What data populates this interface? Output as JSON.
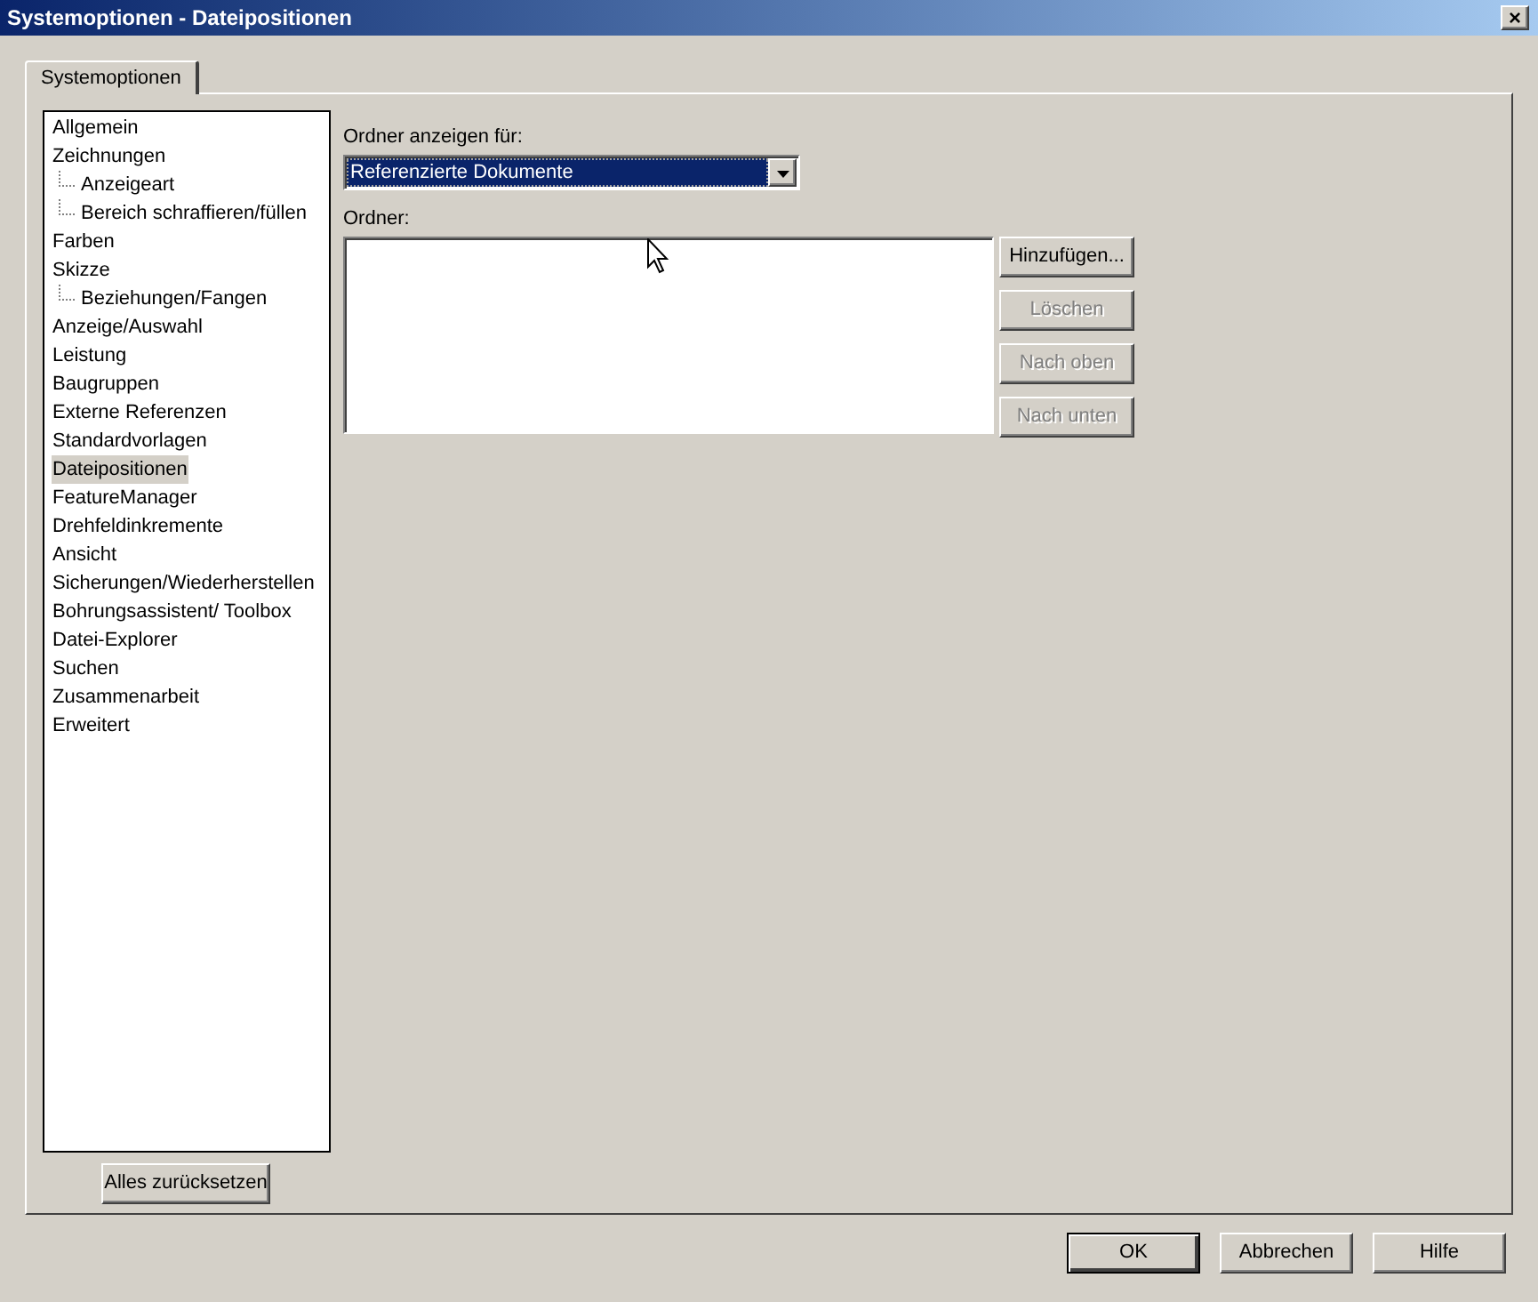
{
  "window": {
    "title": "Systemoptionen - Dateipositionen",
    "close": "×"
  },
  "tabs": [
    {
      "label": "Systemoptionen",
      "selected": true
    }
  ],
  "tree": {
    "items": [
      {
        "label": "Allgemein",
        "selected": false
      },
      {
        "label": "Zeichnungen",
        "selected": false,
        "children": [
          {
            "label": "Anzeigeart",
            "selected": false
          },
          {
            "label": "Bereich schraffieren/füllen",
            "selected": false
          }
        ]
      },
      {
        "label": "Farben",
        "selected": false
      },
      {
        "label": "Skizze",
        "selected": false,
        "children": [
          {
            "label": "Beziehungen/Fangen",
            "selected": false
          }
        ]
      },
      {
        "label": "Anzeige/Auswahl",
        "selected": false
      },
      {
        "label": "Leistung",
        "selected": false
      },
      {
        "label": "Baugruppen",
        "selected": false
      },
      {
        "label": "Externe Referenzen",
        "selected": false
      },
      {
        "label": "Standardvorlagen",
        "selected": false
      },
      {
        "label": "Dateipositionen",
        "selected": true
      },
      {
        "label": "FeatureManager",
        "selected": false
      },
      {
        "label": "Drehfeldinkremente",
        "selected": false
      },
      {
        "label": "Ansicht",
        "selected": false
      },
      {
        "label": "Sicherungen/Wiederherstellen",
        "selected": false
      },
      {
        "label": "Bohrungsassistent/ Toolbox",
        "selected": false
      },
      {
        "label": "Datei-Explorer",
        "selected": false
      },
      {
        "label": "Suchen",
        "selected": false
      },
      {
        "label": "Zusammenarbeit",
        "selected": false
      },
      {
        "label": "Erweitert",
        "selected": false
      }
    ],
    "reset_button": "Alles zurücksetzen"
  },
  "show_folders_for": {
    "label": "Ordner anzeigen für:",
    "value": "Referenzierte Dokumente"
  },
  "folders": {
    "label": "Ordner:",
    "buttons": [
      {
        "label": "Hinzufügen...",
        "disabled": false
      },
      {
        "label": "Löschen",
        "disabled": true
      },
      {
        "label": "Nach oben",
        "disabled": true
      },
      {
        "label": "Nach unten",
        "disabled": true
      }
    ]
  },
  "buttons": [
    {
      "label": "OK",
      "default": true
    },
    {
      "label": "Abbrechen",
      "default": false
    },
    {
      "label": "Hilfe",
      "default": false
    }
  ]
}
